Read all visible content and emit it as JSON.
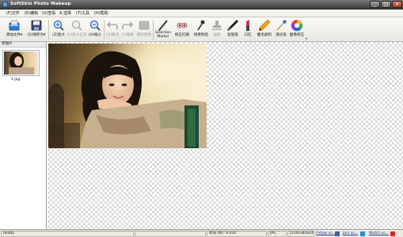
{
  "window": {
    "title": "SoftSkin Photo Makeup"
  },
  "menu": [
    "(F)文件",
    "(E)编辑",
    "(V)查看",
    "A 选择",
    "(T)工具",
    "(H)帮助"
  ],
  "toolbar": {
    "items": [
      {
        "label": "添加文件▾",
        "icon": "add-file-icon",
        "enabled": true
      },
      {
        "label": "(S)保存为▾",
        "icon": "save-as-icon",
        "enabled": true
      },
      {
        "label": "(Z)放大",
        "icon": "zoom-in-icon",
        "enabled": true
      },
      {
        "label": "(U)放大正常",
        "icon": "zoom-normal-icon",
        "enabled": false
      },
      {
        "label": "(O)缩小",
        "icon": "zoom-out-icon",
        "enabled": true
      },
      {
        "label": "(U)撤消",
        "icon": "undo-icon",
        "enabled": false
      },
      {
        "label": "(Y)重做",
        "icon": "redo-icon",
        "enabled": false
      },
      {
        "label": "擦除图像",
        "icon": "erase-image-icon",
        "enabled": false
      },
      {
        "label": "Selection\nMarker",
        "icon": "selection-marker-icon",
        "enabled": true
      },
      {
        "label": "修正红眼",
        "icon": "red-eye-icon",
        "enabled": true
      },
      {
        "label": "残疾制造",
        "icon": "blemish-tool-icon",
        "enabled": true
      },
      {
        "label": "图章",
        "icon": "clone-stamp-icon",
        "enabled": false
      },
      {
        "label": "遮瑕笔",
        "icon": "concealer-icon",
        "enabled": true
      },
      {
        "label": "口红",
        "icon": "lipstick-icon",
        "enabled": true
      },
      {
        "label": "睫毛颜料",
        "icon": "mascara-icon",
        "enabled": true
      },
      {
        "label": "液化笔",
        "icon": "liquify-icon",
        "enabled": true
      },
      {
        "label": "图像校正",
        "icon": "color-correct-icon",
        "enabled": true
      }
    ]
  },
  "left_panel": {
    "header": "原图片",
    "thumbnail_name": "1.jpg"
  },
  "status": {
    "left": "Ready",
    "time": "时间 (秒): 0.010",
    "format": "JPG",
    "dimensions": "(510x340x24)",
    "links": [
      "Follow us...",
      "Join us...",
      "Watch us..."
    ]
  },
  "colors": {
    "titlebar": "#4a4a4a",
    "link": "#1a3c9a",
    "close_button": "#c0401f"
  }
}
